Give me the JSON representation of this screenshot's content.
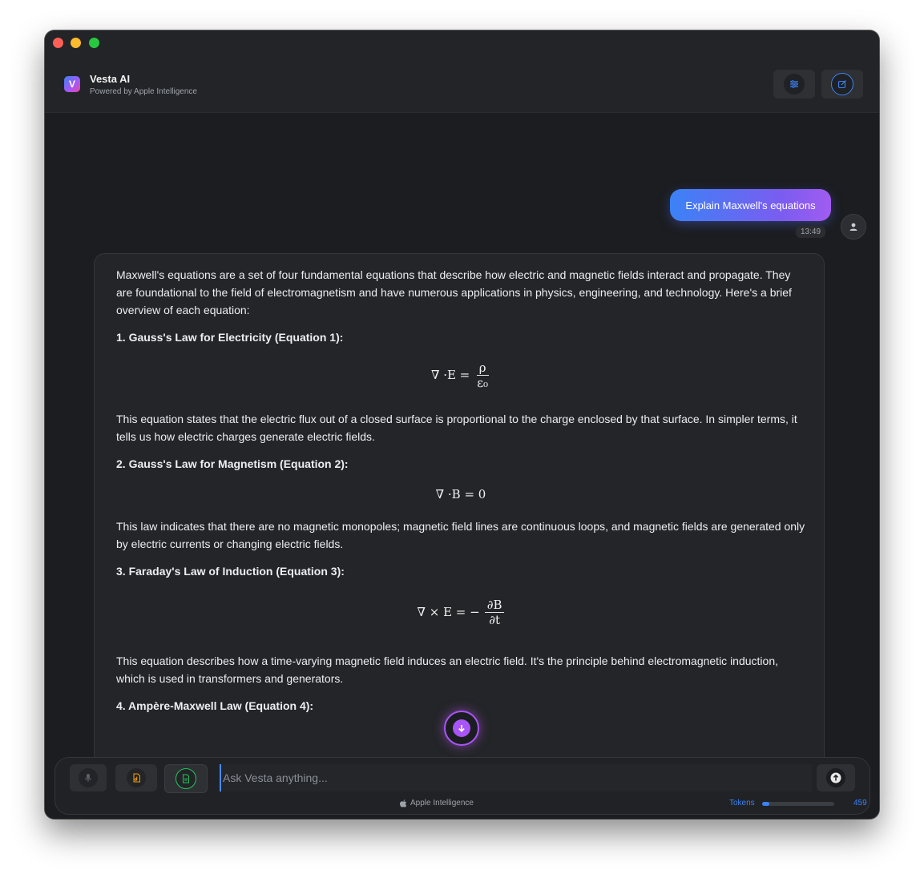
{
  "app": {
    "name": "Vesta AI",
    "subtitle": "Powered by Apple Intelligence",
    "logo_letter": "V"
  },
  "header": {
    "buttons": [
      {
        "icon": "sliders-icon"
      },
      {
        "icon": "new-chat-icon"
      }
    ]
  },
  "conversation": {
    "user_message": "Explain Maxwell's equations",
    "user_time": "13:49",
    "ai": {
      "intro": "Maxwell's equations are a set of four fundamental equations that describe how electric and magnetic fields interact and propagate. They are foundational to the field of electromagnetism and have numerous applications in physics, engineering, and technology. Here's a brief overview of each equation:",
      "sections": [
        {
          "heading": "1. Gauss's Law for Electricity (Equation 1):",
          "lhs": "∇ ·E =",
          "num": "ρ",
          "den": "ε₀",
          "text": "This equation states that the electric flux out of a closed surface is proportional to the charge enclosed by that surface. In simpler terms, it tells us how electric charges generate electric fields."
        },
        {
          "heading": "2. Gauss's Law for Magnetism (Equation 2):",
          "lhs": "∇ ·B = 0",
          "text": "This law indicates that there are no magnetic monopoles; magnetic field lines are continuous loops, and magnetic fields are generated only by electric currents or changing electric fields."
        },
        {
          "heading": "3. Faraday's Law of Induction (Equation 3):",
          "lhs": "∇ × E = −",
          "num": "∂B",
          "den": "∂t",
          "text": "This equation describes how a time-varying magnetic field induces an electric field. It's the principle behind electromagnetic induction, which is used in transformers and generators."
        },
        {
          "heading": "4. Ampère-Maxwell Law (Equation 4):"
        }
      ]
    }
  },
  "composer": {
    "placeholder": "Ask Vesta anything...",
    "footer_label": "Apple Intelligence",
    "tokens_label": "Tokens",
    "tokens_count": "459",
    "tokens_fraction": 0.1
  },
  "colors": {
    "accent": "#3b82f6",
    "user_bubble_start": "#3b82f6",
    "user_bubble_end": "#a15cf0",
    "scroll_button": "#a855f7"
  }
}
